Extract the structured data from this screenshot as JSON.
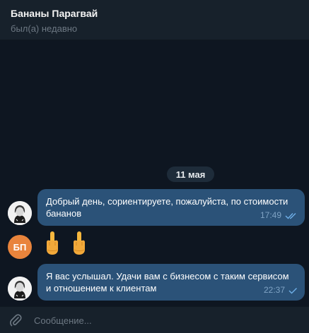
{
  "chat": {
    "title": "Бананы Парагвай",
    "status": "был(а) недавно"
  },
  "date_separator": "11 мая",
  "messages": [
    {
      "text": "Добрый день, сориентируете, пожалуйста, по стоимости бананов",
      "time": "17:49",
      "status": "read"
    },
    {
      "sender_initials": "БП",
      "emoji": [
        "middle-finger",
        "middle-finger"
      ]
    },
    {
      "text": "Я вас услышал. Удачи вам с бизнесом с таким сервисом и отношением к клиентам",
      "time": "22:37",
      "status": "sent"
    }
  ],
  "composer": {
    "placeholder": "Сообщение...",
    "attach_icon": "paperclip-icon"
  },
  "colors": {
    "background": "#0e1621",
    "header": "#17212b",
    "outgoing_bubble": "#2b5278",
    "check": "#6fb0e8",
    "avatar_bp": "#e9843c"
  }
}
